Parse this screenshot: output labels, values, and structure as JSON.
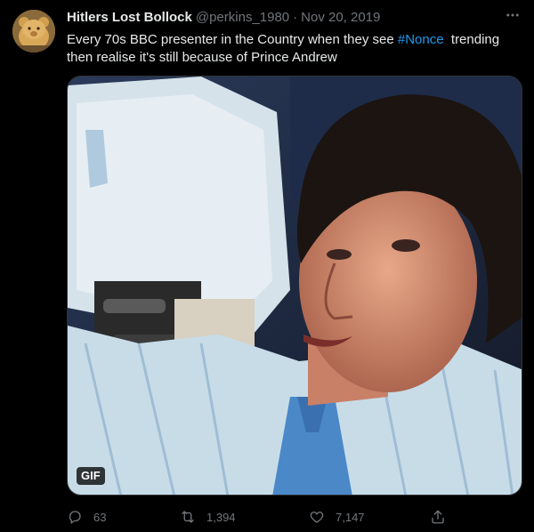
{
  "tweet": {
    "display_name": "Hitlers Lost Bollock",
    "handle": "@perkins_1980",
    "separator": "·",
    "date": "Nov 20, 2019",
    "text_before": "Every 70s BBC presenter in the Country when they see ",
    "hashtag": "#Nonce",
    "text_after": "  trending then realise it's still because of Prince Andrew",
    "media_badge": "GIF"
  },
  "actions": {
    "reply_count": "63",
    "retweet_count": "1,394",
    "like_count": "7,147"
  },
  "icons": {
    "more": "more-horizontal-icon",
    "reply": "reply-icon",
    "retweet": "retweet-icon",
    "like": "heart-icon",
    "share": "share-icon"
  },
  "colors": {
    "background": "#000000",
    "text": "#e7e9ea",
    "muted": "#71767b",
    "hashtag": "#1d9bf0"
  }
}
